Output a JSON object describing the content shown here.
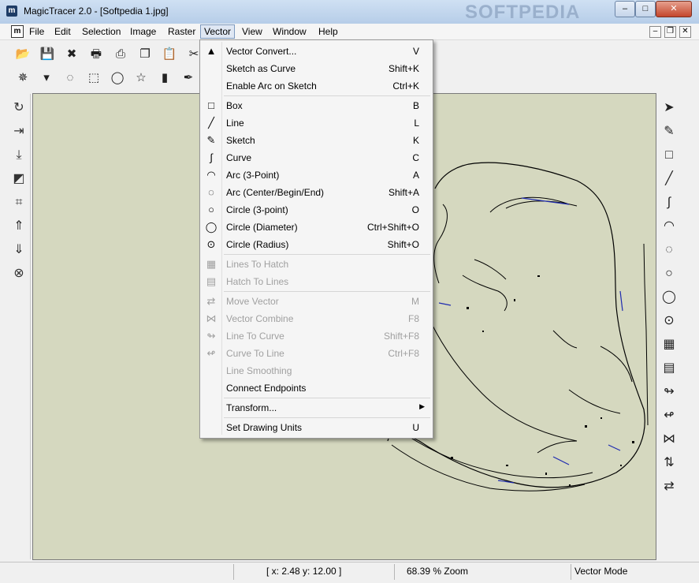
{
  "window": {
    "title": "MagicTracer 2.0 - [Softpedia 1.jpg]",
    "app_icon": "m",
    "watermark": "SOFTPEDIA",
    "controls": {
      "minimize": "–",
      "maximize": "□",
      "close": "✕"
    }
  },
  "menubar": {
    "items": [
      "File",
      "Edit",
      "Selection",
      "Image",
      "Raster",
      "Vector",
      "View",
      "Window",
      "Help"
    ],
    "active": "Vector",
    "mdi_controls": {
      "minimize": "–",
      "restore": "❐",
      "close": "✕"
    }
  },
  "vector_menu": {
    "groups": [
      [
        {
          "label": "Vector Convert...",
          "shortcut": "V",
          "icon": "vector-convert-icon",
          "glyph": "▲",
          "enabled": true
        },
        {
          "label": "Sketch as Curve",
          "shortcut": "Shift+K",
          "icon": "",
          "glyph": "",
          "enabled": true
        },
        {
          "label": "Enable Arc on Sketch",
          "shortcut": "Ctrl+K",
          "icon": "",
          "glyph": "",
          "enabled": true
        }
      ],
      [
        {
          "label": "Box",
          "shortcut": "B",
          "icon": "box-icon",
          "glyph": "□",
          "enabled": true
        },
        {
          "label": "Line",
          "shortcut": "L",
          "icon": "line-icon",
          "glyph": "╱",
          "enabled": true
        },
        {
          "label": "Sketch",
          "shortcut": "K",
          "icon": "pencil-icon",
          "glyph": "✎",
          "enabled": true
        },
        {
          "label": "Curve",
          "shortcut": "C",
          "icon": "curve-icon",
          "glyph": "∫",
          "enabled": true
        },
        {
          "label": "Arc (3-Point)",
          "shortcut": "A",
          "icon": "arc-3point-icon",
          "glyph": "◠",
          "enabled": true
        },
        {
          "label": "Arc (Center/Begin/End)",
          "shortcut": "Shift+A",
          "icon": "arc-center-icon",
          "glyph": "◌",
          "enabled": true
        },
        {
          "label": "Circle (3-point)",
          "shortcut": "O",
          "icon": "circle-3point-icon",
          "glyph": "○",
          "enabled": true
        },
        {
          "label": "Circle (Diameter)",
          "shortcut": "Ctrl+Shift+O",
          "icon": "circle-diameter-icon",
          "glyph": "◯",
          "enabled": true
        },
        {
          "label": "Circle (Radius)",
          "shortcut": "Shift+O",
          "icon": "circle-radius-icon",
          "glyph": "⊙",
          "enabled": true
        }
      ],
      [
        {
          "label": "Lines To Hatch",
          "shortcut": "",
          "icon": "lines-to-hatch-icon",
          "glyph": "▦",
          "enabled": false
        },
        {
          "label": "Hatch To Lines",
          "shortcut": "",
          "icon": "hatch-to-lines-icon",
          "glyph": "▤",
          "enabled": false
        }
      ],
      [
        {
          "label": "Move Vector",
          "shortcut": "M",
          "icon": "move-vector-icon",
          "glyph": "⇄",
          "enabled": false
        },
        {
          "label": "Vector Combine",
          "shortcut": "F8",
          "icon": "vector-combine-icon",
          "glyph": "⋈",
          "enabled": false
        },
        {
          "label": "Line To Curve",
          "shortcut": "Shift+F8",
          "icon": "line-to-curve-icon",
          "glyph": "↬",
          "enabled": false
        },
        {
          "label": "Curve To Line",
          "shortcut": "Ctrl+F8",
          "icon": "curve-to-line-icon",
          "glyph": "↫",
          "enabled": false
        },
        {
          "label": "Line Smoothing",
          "shortcut": "",
          "icon": "",
          "glyph": "",
          "enabled": false
        },
        {
          "label": "Connect Endpoints",
          "shortcut": "",
          "icon": "",
          "glyph": "",
          "enabled": true
        }
      ],
      [
        {
          "label": "Transform...",
          "shortcut": "",
          "icon": "",
          "glyph": "",
          "enabled": true,
          "submenu": true
        }
      ],
      [
        {
          "label": "Set Drawing Units",
          "shortcut": "U",
          "icon": "",
          "glyph": "",
          "enabled": true
        }
      ]
    ],
    "submenu_arrow": "▶"
  },
  "toolbar1": [
    {
      "name": "open-icon",
      "glyph": "📂"
    },
    {
      "name": "save-icon",
      "glyph": "💾"
    },
    {
      "name": "delete-icon",
      "glyph": "✖"
    },
    {
      "name": "print-icon",
      "glyph": "🖶"
    },
    {
      "name": "scan-icon",
      "glyph": "⎙"
    },
    {
      "name": "copy-icon",
      "glyph": "❐"
    },
    {
      "name": "paste-icon",
      "glyph": "📋"
    },
    {
      "name": "cut-icon",
      "glyph": "✂"
    }
  ],
  "toolbar2": [
    {
      "name": "magic-wand-icon",
      "glyph": "✵"
    },
    {
      "name": "dropdown-arrow-icon",
      "glyph": "▾"
    },
    {
      "name": "lasso-icon",
      "glyph": "◌"
    },
    {
      "name": "rect-select-icon",
      "glyph": "⬚"
    },
    {
      "name": "ellipse-select-icon",
      "glyph": "◯"
    },
    {
      "name": "star-select-icon",
      "glyph": "☆"
    },
    {
      "name": "eraser-icon",
      "glyph": "▮"
    },
    {
      "name": "pen-icon",
      "glyph": "✒"
    }
  ],
  "leftbar": [
    {
      "name": "rotate-icon",
      "glyph": "↻"
    },
    {
      "name": "flip-horizontal-icon",
      "glyph": "⇥"
    },
    {
      "name": "flip-vertical-icon",
      "glyph": "⤓"
    },
    {
      "name": "resize-icon",
      "glyph": "◩"
    },
    {
      "name": "crop-icon",
      "glyph": "⌗"
    },
    {
      "name": "bring-forward-icon",
      "glyph": "⇑"
    },
    {
      "name": "send-backward-icon",
      "glyph": "⇓"
    },
    {
      "name": "clear-icon",
      "glyph": "⊗"
    }
  ],
  "rightbar": [
    {
      "name": "pointer-icon",
      "glyph": "➤"
    },
    {
      "name": "pencil-tool-icon",
      "glyph": "✎"
    },
    {
      "name": "box-tool-icon",
      "glyph": "□"
    },
    {
      "name": "line-tool-icon",
      "glyph": "╱"
    },
    {
      "name": "curve-tool-icon",
      "glyph": "∫"
    },
    {
      "name": "arc-tool-icon",
      "glyph": "◠"
    },
    {
      "name": "arc-center-tool-icon",
      "glyph": "◌"
    },
    {
      "name": "circle-tool-icon",
      "glyph": "○"
    },
    {
      "name": "circle-diameter-tool-icon",
      "glyph": "◯"
    },
    {
      "name": "circle-radius-tool-icon",
      "glyph": "⊙"
    },
    {
      "name": "hatch-tool-icon",
      "glyph": "▦"
    },
    {
      "name": "hatch-lines-tool-icon",
      "glyph": "▤"
    },
    {
      "name": "line-to-curve-tool-icon",
      "glyph": "↬"
    },
    {
      "name": "curve-to-line-tool-icon",
      "glyph": "↫"
    },
    {
      "name": "combine-tool-icon",
      "glyph": "⋈"
    },
    {
      "name": "swap-vertical-icon",
      "glyph": "⇅"
    },
    {
      "name": "swap-horizontal-icon",
      "glyph": "⇄"
    }
  ],
  "status": {
    "coords": "[ x: 2.48 y: 12.00 ]",
    "zoom": "68.39 % Zoom",
    "mode": "Vector Mode"
  }
}
